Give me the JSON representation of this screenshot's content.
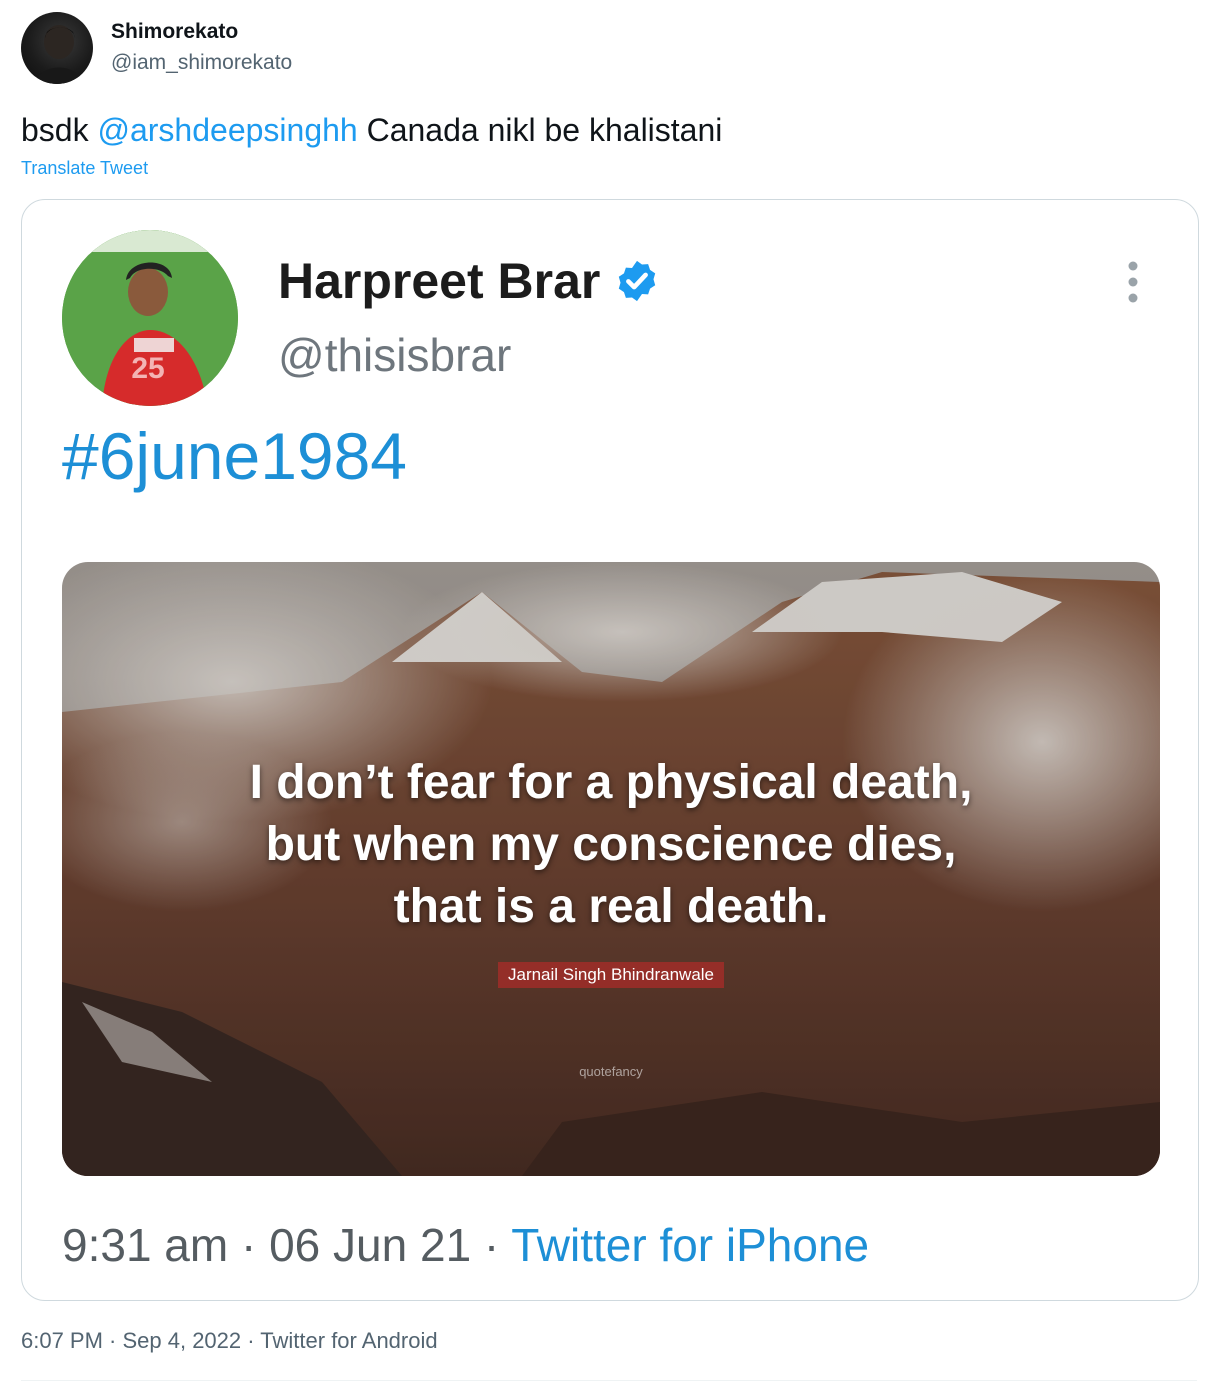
{
  "tweet": {
    "author_name": "Shimorekato",
    "author_handle": "@iam_shimorekato",
    "text_before": "bsdk ",
    "mention": "@arshdeepsinghh",
    "text_after": " Canada nikl be khalistani",
    "translate_label": "Translate Tweet",
    "timestamp": "6:07 PM · Sep 4, 2022 · Twitter for Android"
  },
  "embedded": {
    "name": "Harpreet Brar",
    "handle": "@thisisbrar",
    "hashtag": "#6june1984",
    "quote_lines": [
      "I don’t fear for a physical death,",
      "but when my conscience dies,",
      "that is a real death."
    ],
    "quote_author": "Jarnail Singh Bhindranwale",
    "watermark": "quotefancy",
    "time": "9:31 am · 06 Jun 21 · ",
    "source": "Twitter for iPhone"
  },
  "colors": {
    "link": "#1d9bf0",
    "verified": "#1d9bf0",
    "muted": "#536471"
  },
  "icons": [
    "user-avatar",
    "verified-badge-icon",
    "more-options-icon"
  ]
}
